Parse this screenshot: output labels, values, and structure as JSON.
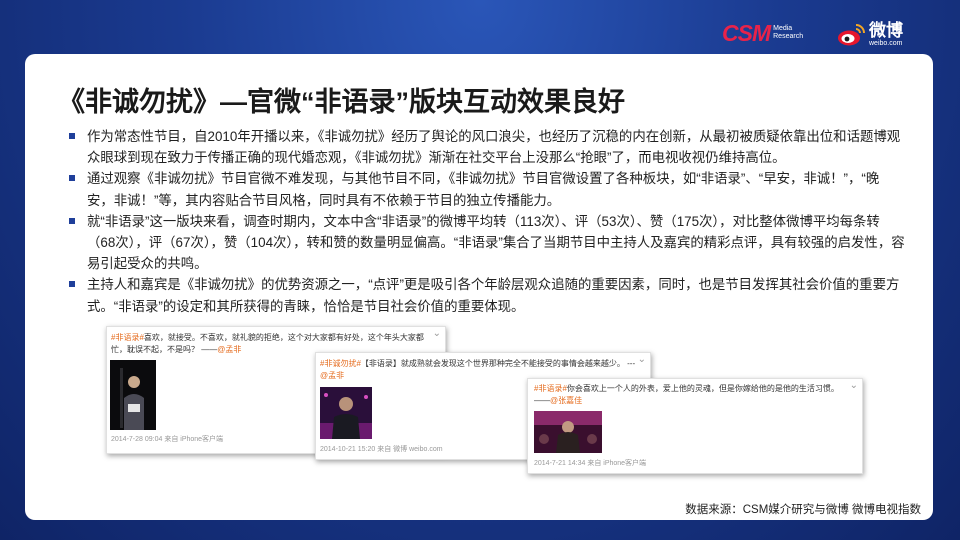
{
  "header": {
    "csm_logo": "CSM",
    "csm_sub": [
      "Media",
      "Research"
    ],
    "weibo_cn": "微博",
    "weibo_en": "weibo.com"
  },
  "title": "《非诚勿扰》—官微“非语录”版块互动效果良好",
  "bullets": [
    "作为常态性节目，自2010年开播以来，《非诚勿扰》经历了舆论的风口浪尖，也经历了沉稳的内在创新，从最初被质疑依靠出位和话题博观众眼球到现在致力于传播正确的现代婚恋观，《非诚勿扰》渐渐在社交平台上没那么“抢眼”了，而电视收视仍维持高位。",
    "通过观察《非诚勿扰》节目官微不难发现，与其他节目不同，《非诚勿扰》节目官微设置了各种板块，如“非语录”、“早安，非诚！”，“晚安，非诚！”等，其内容贴合节目风格，同时具有不依赖于节目的独立传播能力。",
    "就“非语录”这一版块来看，调查时期内，文本中含“非语录”的微博平均转（113次）、评（53次）、赞（175次），对比整体微博平均每条转（68次），评（67次），赞（104次），转和赞的数量明显偏高。“非语录”集合了当期节目中主持人及嘉宾的精彩点评，具有较强的启发性，容易引起受众的共鸣。",
    "主持人和嘉宾是《非诚勿扰》的优势资源之一，“点评”更是吸引各个年龄层观众追随的重要因素，同时，也是节目发挥其社会价值的重要方式。“非语录”的设定和其所获得的青睐，恰恰是节目社会价值的重要体现。"
  ],
  "posts": [
    {
      "tag": "#非语录#",
      "body": "喜欢，就接受。不喜欢，就礼貌的拒绝，这个对大家都有好处，这个年头大家都忙，耽误不起，不是吗？ ——",
      "mention": "@孟非",
      "meta": "2014-7-28 09:04 来自 iPhone客户端"
    },
    {
      "tag": "#非诚勿扰#",
      "body": "【非语录】就成熟就会发现这个世界那种完全不能接受的事情会越来越少。 ---",
      "mention": "@孟非",
      "meta": "2014-10-21 15:20 来自 微博 weibo.com"
    },
    {
      "tag": "#非语录#",
      "body": "你会喜欢上一个人的外表，爱上他的灵魂，但是你嫁给他的是他的生活习惯。 ——",
      "mention": "@张嘉佳",
      "meta": "2014-7-21 14:34 来自 iPhone客户端"
    }
  ],
  "source": "数据来源：CSM媒介研究与微博 微博电视指数",
  "colors": {
    "accent": "#1f3f9a",
    "csm_red": "#e8234a",
    "highlight": "#e56c1f"
  }
}
